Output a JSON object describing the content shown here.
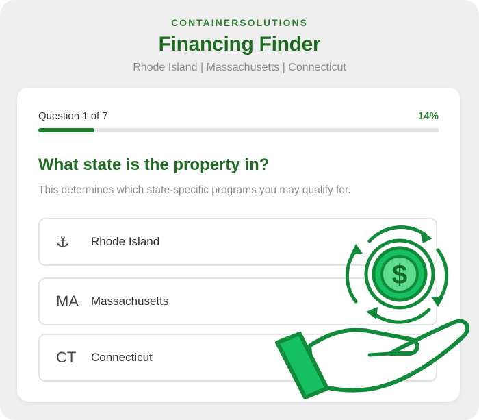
{
  "header": {
    "brand": "CONTAINERSOLUTIONS",
    "title": "Financing Finder",
    "subtitle": "Rhode Island | Massachusetts | Connecticut"
  },
  "progress": {
    "label": "Question 1 of 7",
    "percent_label": "14%",
    "fraction": 0.14
  },
  "question": {
    "title": "What state is the property in?",
    "help": "This determines which state-specific programs you may qualify for."
  },
  "options": [
    {
      "icon": "⚓",
      "icon_name": "anchor-icon",
      "label": "Rhode Island"
    },
    {
      "icon": "MA",
      "icon_name": "ma-abbreviation",
      "label": "Massachusetts"
    },
    {
      "icon": "CT",
      "icon_name": "ct-abbreviation",
      "label": "Connecticut"
    }
  ],
  "illustration": {
    "icon_name": "hand-holding-dollar-coin-icon",
    "symbol": "$"
  },
  "colors": {
    "brand_green": "#2e7d32",
    "dark_green": "#1e6b22",
    "accent_green": "#1aa24a",
    "light_green": "#10c76a"
  }
}
